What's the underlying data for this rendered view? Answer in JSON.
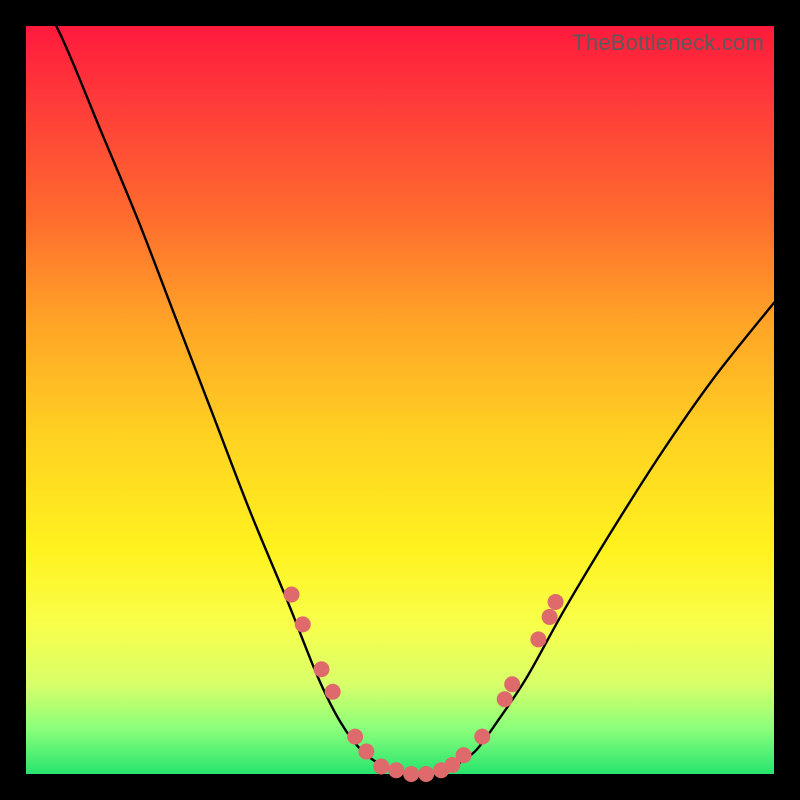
{
  "attribution": "TheBottleneck.com",
  "colors": {
    "marker": "#de6a6c",
    "curve": "#000000",
    "gradient_top": "#ff1a3c",
    "gradient_bottom": "#26e46e",
    "frame": "#000000"
  },
  "chart_data": {
    "type": "line",
    "title": "",
    "xlabel": "",
    "ylabel": "",
    "xlim": [
      0,
      100
    ],
    "ylim": [
      0,
      100
    ],
    "x": [
      0,
      5,
      10,
      15,
      20,
      25,
      30,
      35,
      39,
      42,
      45,
      48,
      51,
      54,
      57,
      60,
      63,
      67,
      72,
      78,
      85,
      92,
      100
    ],
    "y": [
      108,
      98,
      86,
      74,
      61,
      48,
      35,
      23,
      13,
      7,
      3,
      1,
      0,
      0,
      1,
      3,
      7,
      13,
      22,
      32,
      43,
      53,
      63
    ],
    "markers": [
      {
        "x": 35.5,
        "y": 24
      },
      {
        "x": 37.0,
        "y": 20
      },
      {
        "x": 39.5,
        "y": 14
      },
      {
        "x": 41.0,
        "y": 11
      },
      {
        "x": 44.0,
        "y": 5
      },
      {
        "x": 45.5,
        "y": 3
      },
      {
        "x": 47.5,
        "y": 1
      },
      {
        "x": 49.5,
        "y": 0.5
      },
      {
        "x": 51.5,
        "y": 0
      },
      {
        "x": 53.5,
        "y": 0
      },
      {
        "x": 55.5,
        "y": 0.5
      },
      {
        "x": 57.0,
        "y": 1.2
      },
      {
        "x": 58.5,
        "y": 2.5
      },
      {
        "x": 61.0,
        "y": 5
      },
      {
        "x": 64.0,
        "y": 10
      },
      {
        "x": 65.0,
        "y": 12
      },
      {
        "x": 68.5,
        "y": 18
      },
      {
        "x": 70.0,
        "y": 21
      },
      {
        "x": 70.8,
        "y": 23
      }
    ],
    "marker_radius": 8
  }
}
